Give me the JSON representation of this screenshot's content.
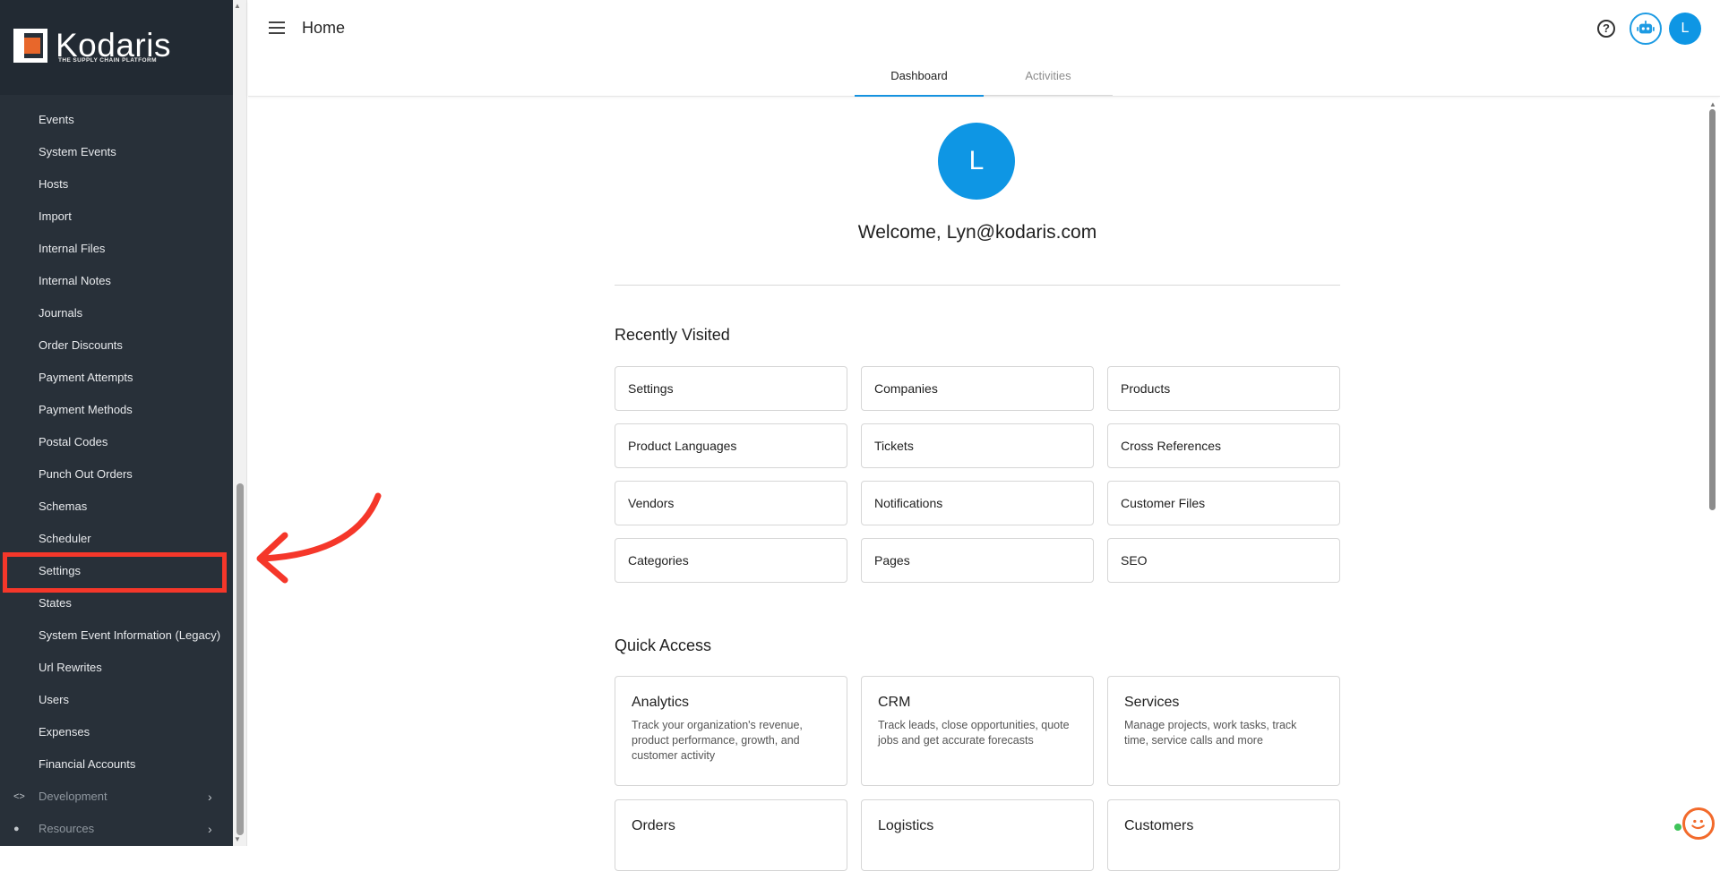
{
  "brand": {
    "name": "Kodaris",
    "tagline": "THE SUPPLY CHAIN PLATFORM",
    "logo_color": "#e8672b"
  },
  "sidebar": {
    "items": [
      {
        "label": "Events"
      },
      {
        "label": "System Events"
      },
      {
        "label": "Hosts"
      },
      {
        "label": "Import"
      },
      {
        "label": "Internal Files"
      },
      {
        "label": "Internal Notes"
      },
      {
        "label": "Journals"
      },
      {
        "label": "Order Discounts"
      },
      {
        "label": "Payment Attempts"
      },
      {
        "label": "Payment Methods"
      },
      {
        "label": "Postal Codes"
      },
      {
        "label": "Punch Out Orders"
      },
      {
        "label": "Schemas"
      },
      {
        "label": "Scheduler"
      },
      {
        "label": "Settings"
      },
      {
        "label": "States"
      },
      {
        "label": "System Event Information (Legacy)"
      },
      {
        "label": "Url Rewrites"
      },
      {
        "label": "Users"
      },
      {
        "label": "Expenses"
      },
      {
        "label": "Financial Accounts"
      }
    ],
    "groups": [
      {
        "label": "Development",
        "icon": "code-icon"
      },
      {
        "label": "Resources",
        "icon": "help-circle-icon"
      }
    ],
    "highlighted_item": "Settings",
    "highlight_color": "#f5372a"
  },
  "header": {
    "title": "Home",
    "user_initial": "L",
    "tabs": [
      {
        "label": "Dashboard",
        "active": true
      },
      {
        "label": "Activities",
        "active": false
      }
    ]
  },
  "main": {
    "avatar_initial": "L",
    "welcome": "Welcome, Lyn@kodaris.com",
    "recently_visited": {
      "title": "Recently Visited",
      "items": [
        "Settings",
        "Companies",
        "Products",
        "Product Languages",
        "Tickets",
        "Cross References",
        "Vendors",
        "Notifications",
        "Customer Files",
        "Categories",
        "Pages",
        "SEO"
      ]
    },
    "quick_access": {
      "title": "Quick Access",
      "items": [
        {
          "title": "Analytics",
          "desc": "Track your organization's revenue, product performance, growth, and customer activity"
        },
        {
          "title": "CRM",
          "desc": "Track leads, close opportunities, quote jobs and get accurate forecasts"
        },
        {
          "title": "Services",
          "desc": "Manage projects, work tasks, track time, service calls and more"
        },
        {
          "title": "Orders",
          "desc": ""
        },
        {
          "title": "Logistics",
          "desc": ""
        },
        {
          "title": "Customers",
          "desc": ""
        }
      ]
    }
  },
  "colors": {
    "accent": "#0e96e4",
    "sidebar_bg": "#283039"
  }
}
